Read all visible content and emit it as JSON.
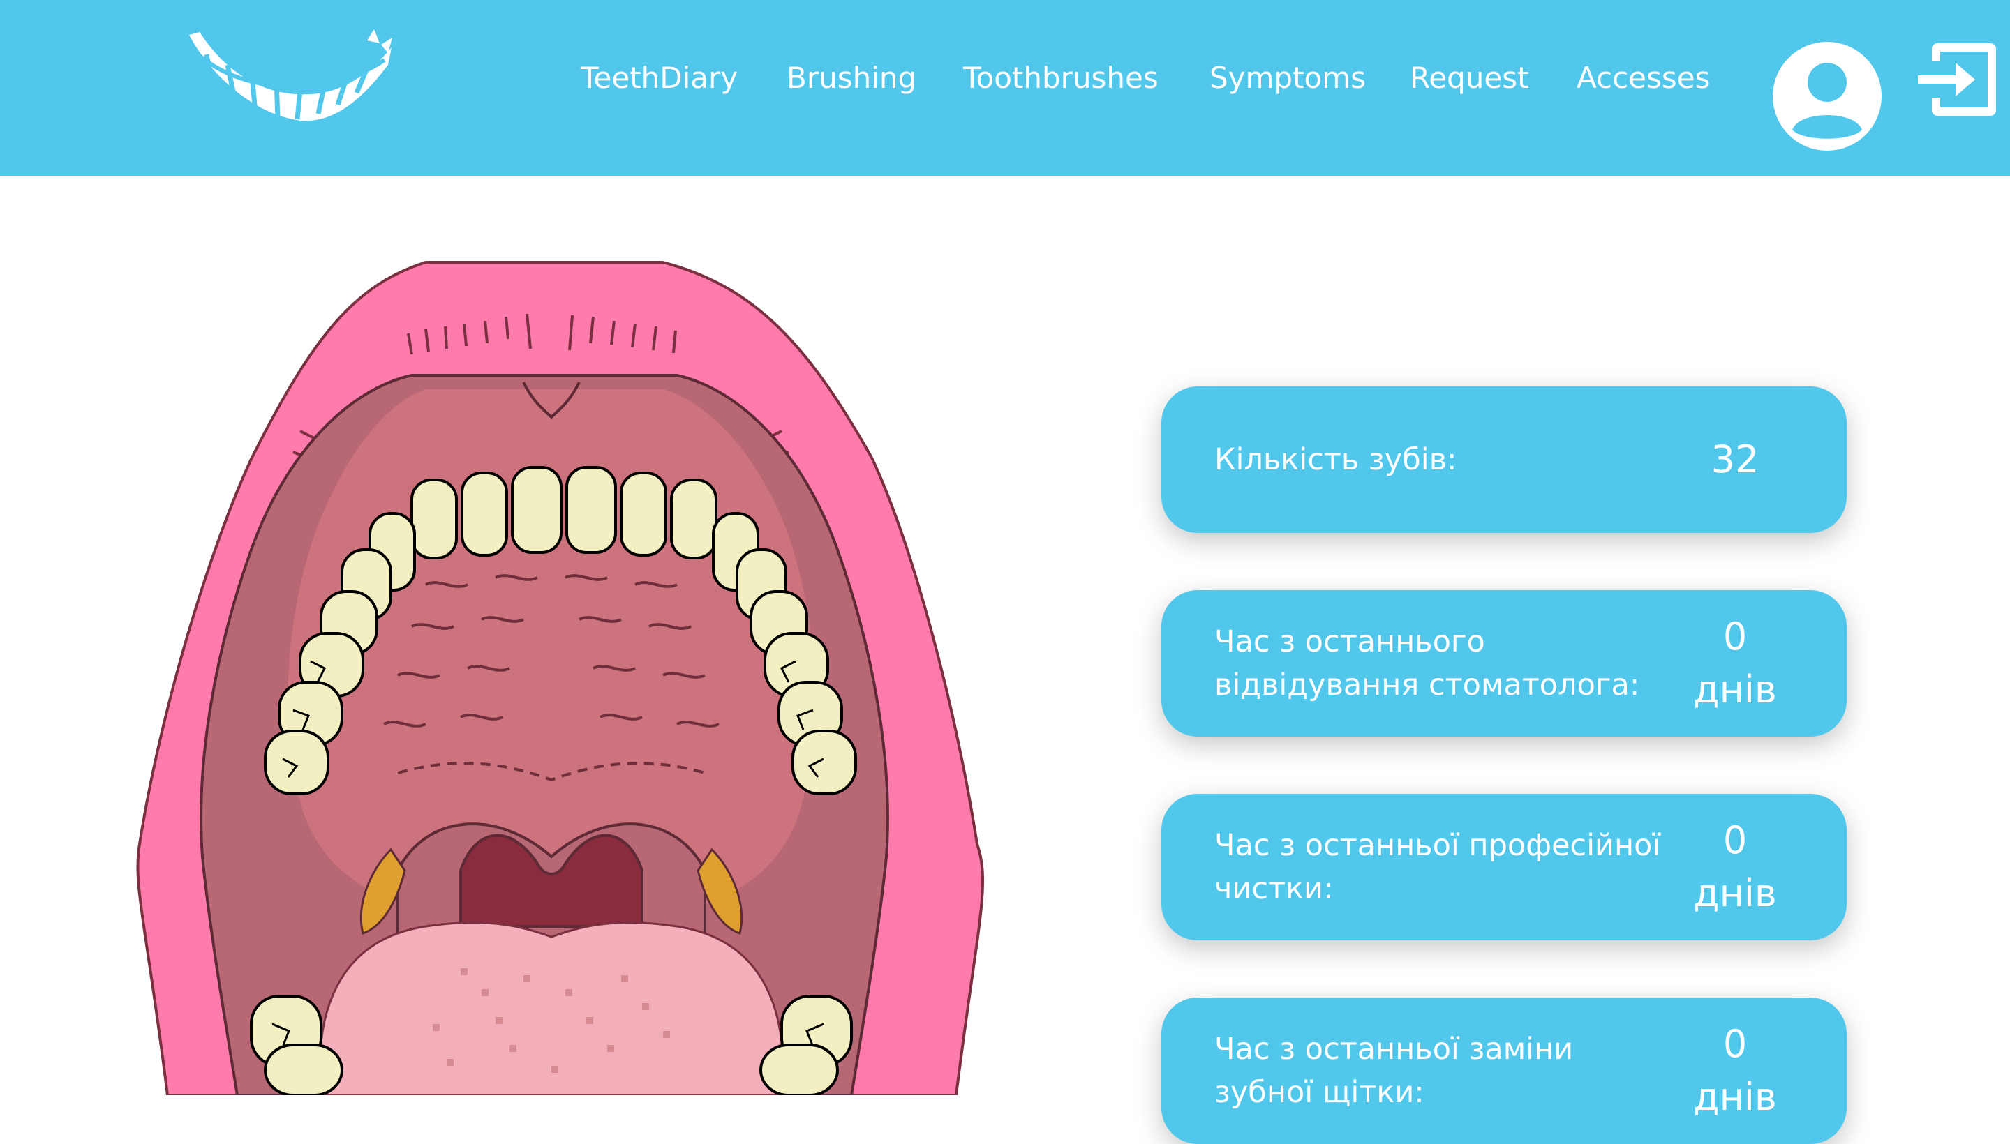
{
  "header": {
    "logo_icon": "smile-teeth-logo",
    "nav": [
      {
        "label": "TeethDiary"
      },
      {
        "label": "Brushing"
      },
      {
        "label": "Toothbrushes"
      },
      {
        "label": "Symptoms"
      },
      {
        "label": "Request"
      },
      {
        "label": "Accesses"
      }
    ],
    "user_icon": "user-circle-icon",
    "logout_icon": "logout-icon"
  },
  "illustration": {
    "name": "open-mouth-illustration"
  },
  "stats": [
    {
      "label": "Кількість зубів:",
      "value": "32",
      "unit": ""
    },
    {
      "label": "Час з останнього відвідування стоматолога:",
      "value": "0",
      "unit": "днів"
    },
    {
      "label": "Час з останньої професійної чистки:",
      "value": "0",
      "unit": "днів"
    },
    {
      "label": "Час з останньої заміни зубної щітки:",
      "value": "0",
      "unit": "днів"
    }
  ],
  "colors": {
    "accent": "#52c7ec",
    "lips": "#ff7bac",
    "palate": "#c9707a",
    "tongue": "#f4b0ba",
    "teeth": "#f2efc2"
  }
}
